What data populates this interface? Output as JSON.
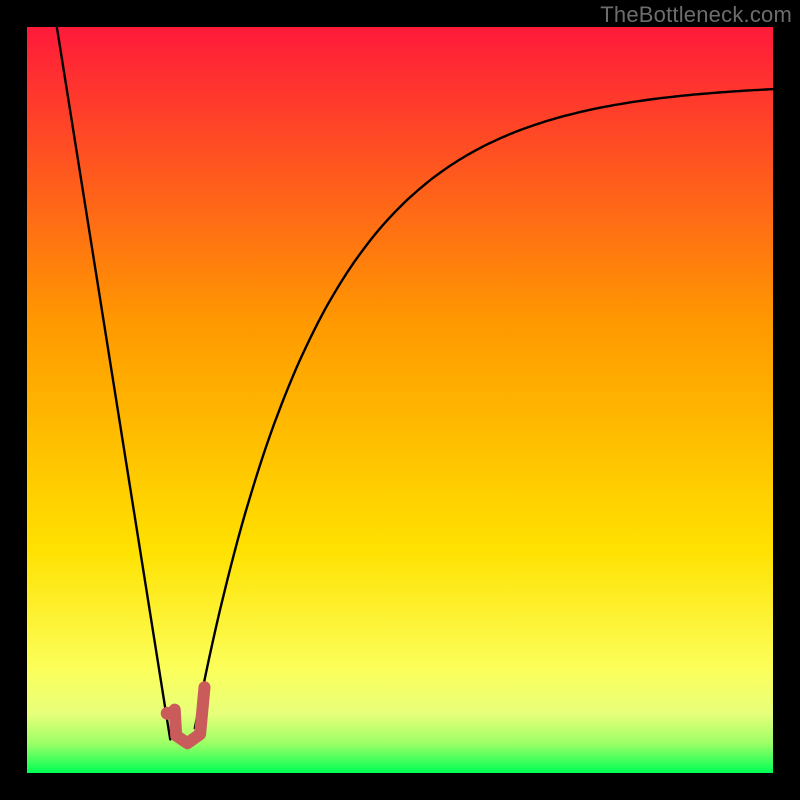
{
  "watermark": "TheBottleneck.com",
  "colors": {
    "background": "#000000",
    "gradient_top": "#ff1a3a",
    "gradient_mid": "#ffb000",
    "gradient_low": "#fcff2e",
    "gradient_bottom": "#00ff55",
    "curve": "#000000",
    "marker": "#c95b5b"
  },
  "chart_data": {
    "type": "line",
    "title": "",
    "xlabel": "",
    "ylabel": "",
    "xlim": [
      0,
      100
    ],
    "ylim": [
      0,
      100
    ],
    "series": [
      {
        "name": "line-left",
        "kind": "segment",
        "points": [
          {
            "x": 4.0,
            "y": 100.0
          },
          {
            "x": 19.2,
            "y": 4.5
          }
        ]
      },
      {
        "name": "curve-right",
        "kind": "curve",
        "start": {
          "x": 22.5,
          "y": 6.0
        },
        "end": {
          "x": 100.0,
          "y": 92.5
        },
        "shape": "saturating-rise"
      }
    ],
    "marker_series": {
      "name": "J-marker",
      "stroke_width_pct": 1.6,
      "points": [
        {
          "x": 19.8,
          "y": 8.5
        },
        {
          "x": 20.0,
          "y": 5.0
        },
        {
          "x": 21.5,
          "y": 4.0
        },
        {
          "x": 23.2,
          "y": 5.2
        },
        {
          "x": 23.8,
          "y": 11.5
        }
      ],
      "dot": {
        "x": 18.8,
        "y": 8.0
      }
    }
  }
}
